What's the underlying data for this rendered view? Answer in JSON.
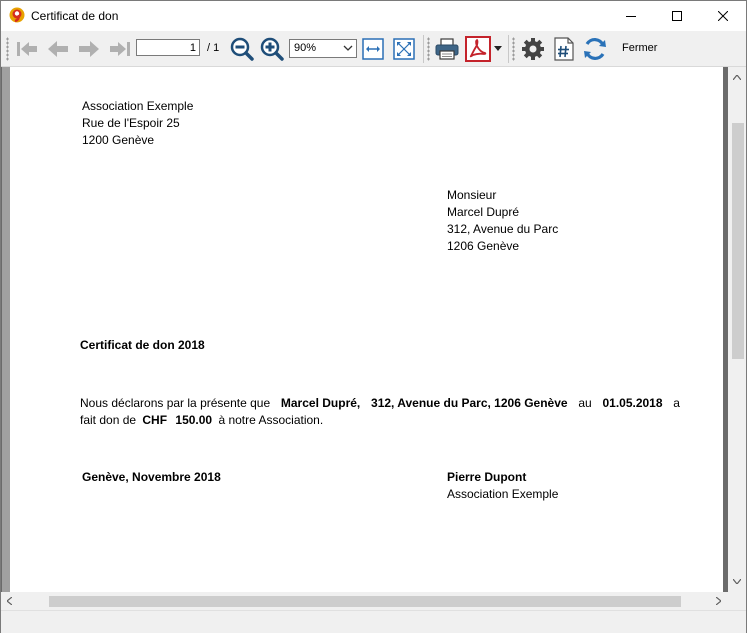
{
  "window": {
    "title": "Certificat de don"
  },
  "toolbar": {
    "page_value": "1",
    "page_total": "/ 1",
    "zoom_value": "90%",
    "close_label": "Fermer"
  },
  "document": {
    "sender": [
      "Association Exemple",
      "Rue de l'Espoir 25",
      "1200 Genève"
    ],
    "recipient": [
      "Monsieur",
      "Marcel Dupré",
      "312, Avenue du Parc",
      "1206 Genève"
    ],
    "heading": "Certificat de don 2018",
    "body": {
      "t1": "Nous déclarons par la présente que",
      "name": "Marcel Dupré,",
      "address": "312, Avenue du Parc, 1206 Genève",
      "t2": "au",
      "date": "01.05.2018",
      "t3": "a",
      "t4": "fait don de",
      "currency": "CHF",
      "amount": "150.00",
      "t5": "à notre Association."
    },
    "place_date": "Genève, Novembre 2018",
    "signatory_name": "Pierre Dupont",
    "signatory_org": "Association Exemple"
  }
}
